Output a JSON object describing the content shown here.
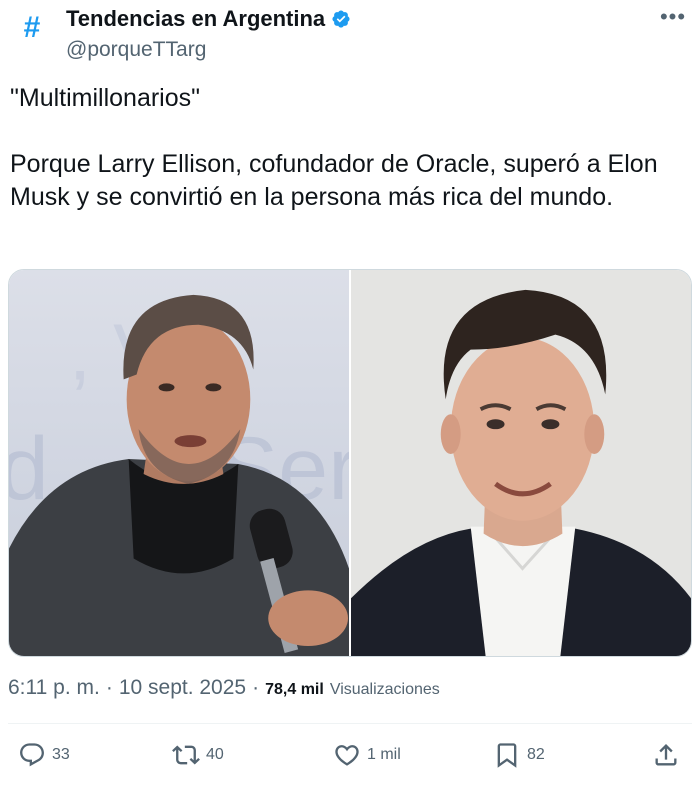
{
  "account": {
    "avatar_symbol": "#",
    "display_name": "Tendencias en Argentina",
    "handle": "@porqueTTarg",
    "verified_color": "#1d9bf0"
  },
  "tweet": {
    "line1": "\"Multimillonarios\"",
    "line2": "Porque Larry Ellison, cofundador de Oracle, superó a Elon Musk y se convirtió en la persona más rica del mundo."
  },
  "media": {
    "left_background_text": "Ser",
    "left_background_text_2": "d"
  },
  "meta": {
    "time": "6:11 p. m.",
    "date": "10 sept. 2025",
    "views_count": "78,4 mil",
    "views_label": "Visualizaciones"
  },
  "actions": {
    "replies": "33",
    "reposts": "40",
    "likes": "1 mil",
    "bookmarks": "82"
  },
  "colors": {
    "accent": "#1d9bf0",
    "text_primary": "#0f1419",
    "text_secondary": "#536471"
  }
}
